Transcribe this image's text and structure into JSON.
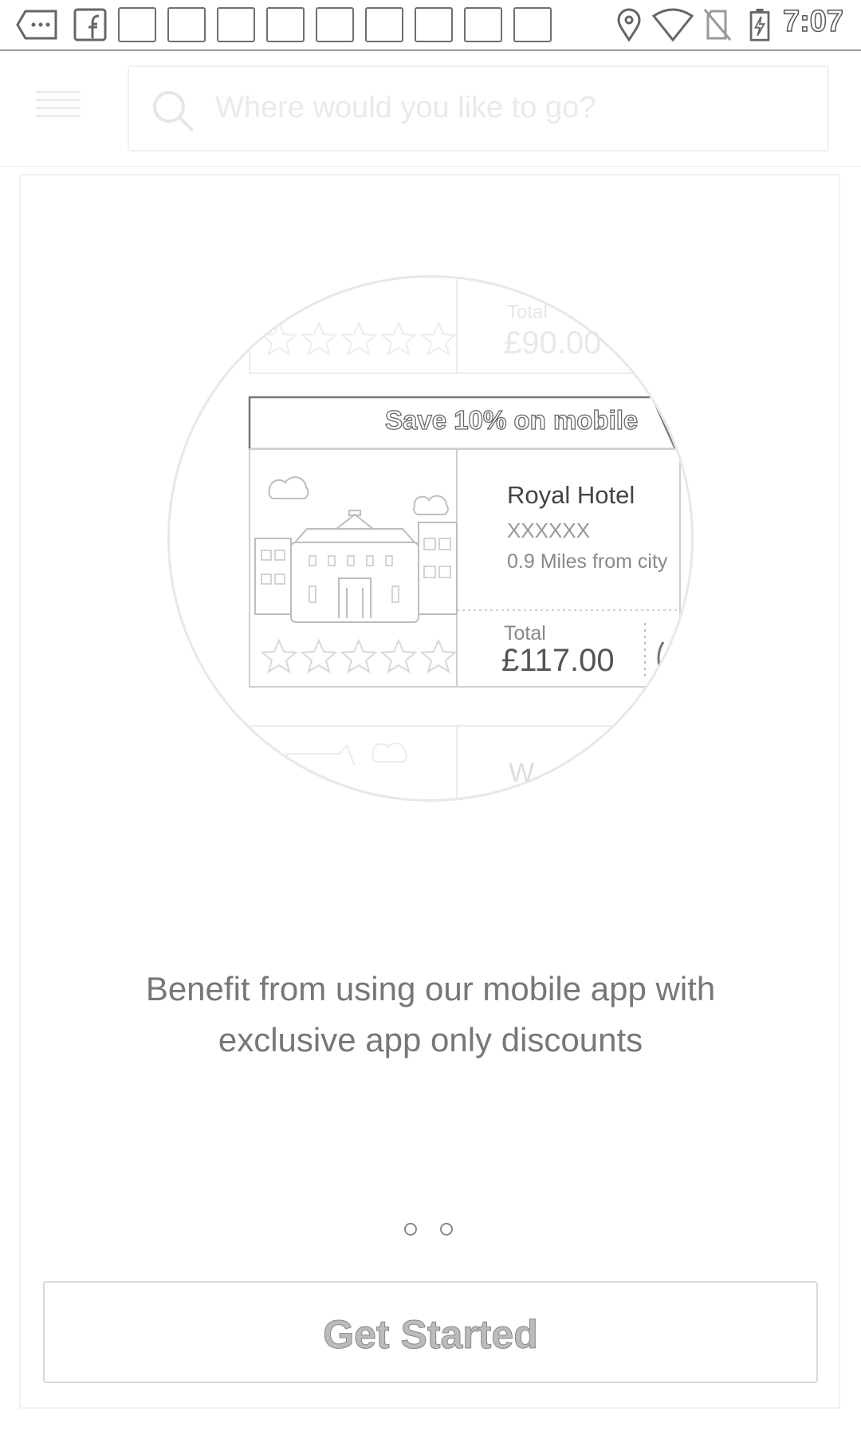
{
  "status_bar": {
    "time": "7:07",
    "icons": [
      "more-icon",
      "facebook-icon",
      "location-icon",
      "wifi-icon",
      "no-sim-icon",
      "battery-charging-icon"
    ]
  },
  "search": {
    "placeholder": "Where would you like to go?"
  },
  "illustration": {
    "ghost_total_label": "Total",
    "ghost_total_price": "£90.00",
    "ribbon_text": "Save 10% on mobile",
    "hotel_name": "Royal Hotel",
    "hotel_sub": "XXXXXX",
    "hotel_distance": "0.9 Miles from city",
    "total_label": "Total",
    "total_price": "£117.00",
    "ghost_next_title": "W"
  },
  "onboarding": {
    "description_line1": "Benefit from using our mobile app with",
    "description_line2": "exclusive app only discounts",
    "page_count": 2,
    "current_page": 1
  },
  "cta": {
    "label": "Get Started"
  }
}
